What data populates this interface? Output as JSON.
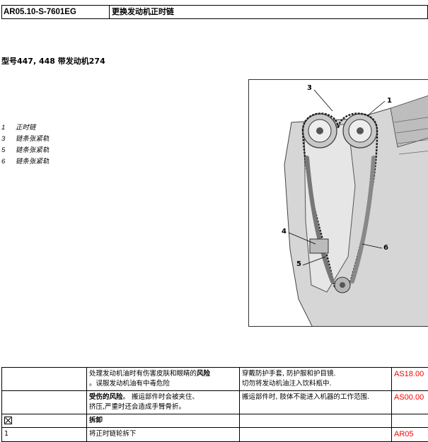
{
  "header": {
    "code": "AR05.10-S-7601EG",
    "title": "更换发动机正时链"
  },
  "model_line": "型号447, 448 带发动机274",
  "legend": [
    {
      "num": "1",
      "label": "正时链"
    },
    {
      "num": "3",
      "label": "链条张紧轨"
    },
    {
      "num": "5",
      "label": "链条张紧轨"
    },
    {
      "num": "6",
      "label": "链条张紧轨"
    }
  ],
  "figure": {
    "callouts": [
      "1",
      "3",
      "4",
      "5",
      "6"
    ]
  },
  "safety_rows": [
    {
      "hazard_pre": "处理发动机油时有伤害皮肤和眼睛的",
      "hazard_bold": "风险",
      "hazard_line2": "。误服发动机油有中毒危险",
      "measure_line1": "穿戴防护手套, 防护服和护目镜.",
      "measure_line2": "切勿将发动机油注入饮料瓶中.",
      "ref": "AS18.00"
    },
    {
      "hazard_bold": "受伤的风险",
      "hazard_post": "。 搬运部件时会被夹住、",
      "hazard_line2": "挤压,严重时还会造成手臂骨折。",
      "measure_line1": "搬运部件时, 肢体不能进入机器的工作范围.",
      "ref": "AS00.00"
    }
  ],
  "section": {
    "icon": "remove-icon",
    "label": "拆卸"
  },
  "step": {
    "num": "1",
    "text": "将正时链轮拆下",
    "ref": "AR05"
  }
}
